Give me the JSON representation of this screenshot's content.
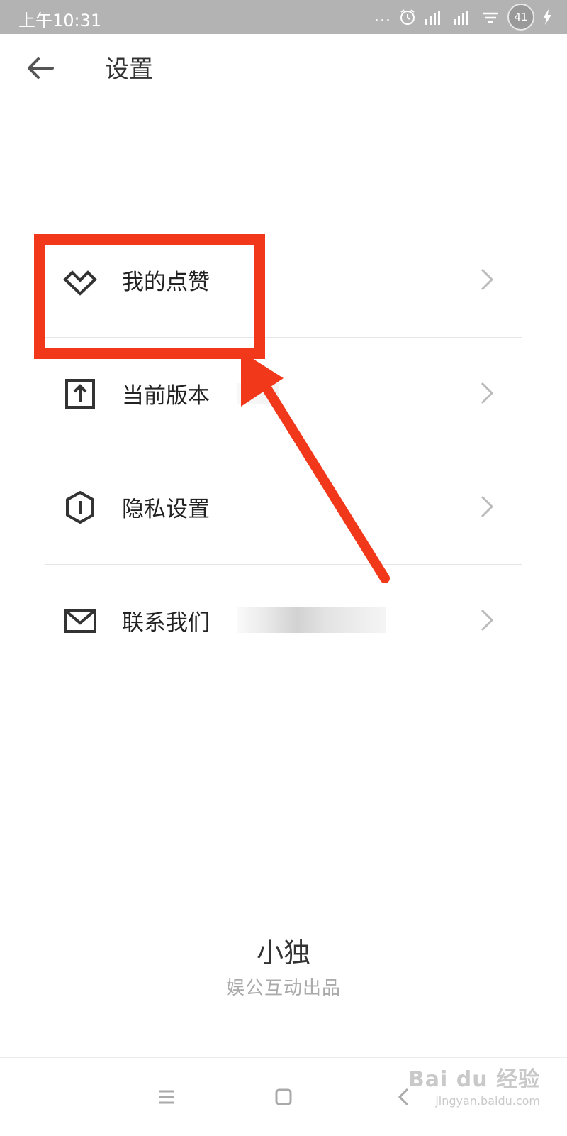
{
  "status_bar": {
    "time": "上午10:31",
    "dots": "...",
    "battery": "41"
  },
  "header": {
    "title": "设置"
  },
  "settings": {
    "items": [
      {
        "label": "我的点赞",
        "icon": "heart-diamond-icon"
      },
      {
        "label": "当前版本",
        "icon": "upload-icon"
      },
      {
        "label": "隐私设置",
        "icon": "shield-hexagon-icon"
      },
      {
        "label": "联系我们",
        "icon": "mail-icon"
      }
    ]
  },
  "footer": {
    "brand": "小独",
    "subtitle": "娱公互动出品"
  },
  "watermark": {
    "main": "Bai du 经验",
    "sub": "jingyan.baidu.com"
  },
  "colors": {
    "annotation": "#f2381a",
    "status_bar": "#b3b3b3"
  }
}
